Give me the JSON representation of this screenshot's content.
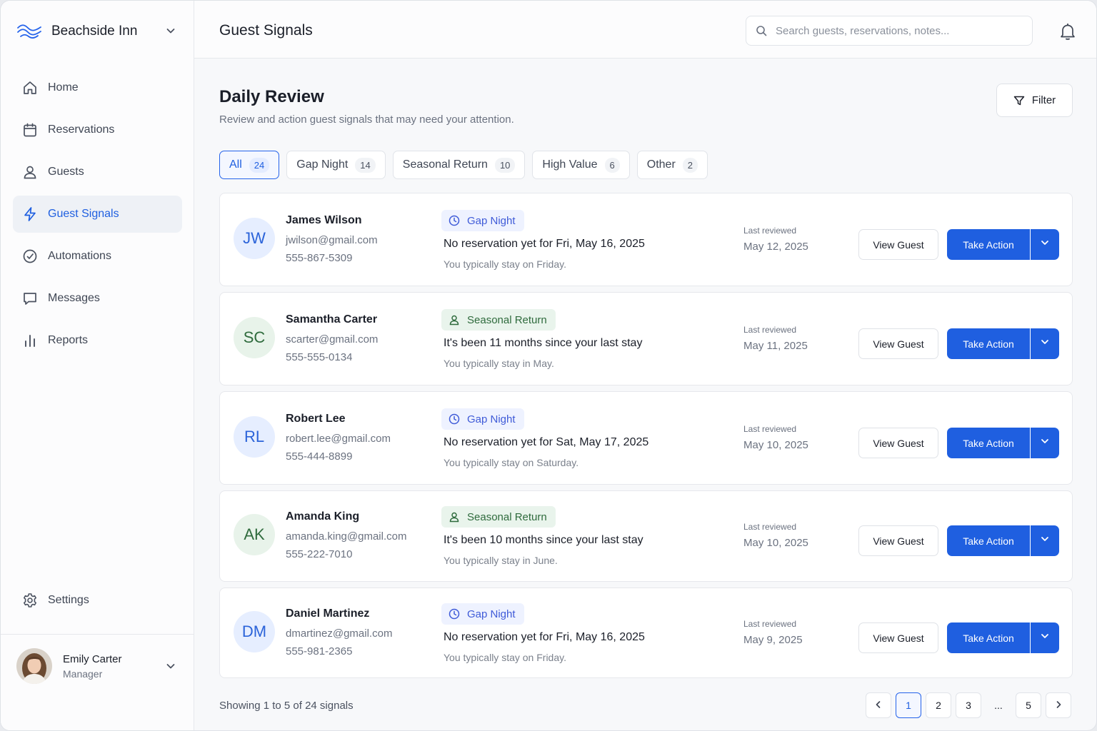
{
  "brand": {
    "name": "Beachside Inn",
    "logo": "waves-icon"
  },
  "sidebar": {
    "items": [
      {
        "label": "Home",
        "icon": "home-icon",
        "key": "home"
      },
      {
        "label": "Reservations",
        "icon": "calendar-icon",
        "key": "reservations"
      },
      {
        "label": "Guests",
        "icon": "user-icon",
        "key": "guests"
      },
      {
        "label": "Guest Signals",
        "icon": "lightning-icon",
        "key": "guest-signals",
        "active": true
      },
      {
        "label": "Automations",
        "icon": "automation-icon",
        "key": "automations"
      },
      {
        "label": "Messages",
        "icon": "message-icon",
        "key": "messages"
      },
      {
        "label": "Reports",
        "icon": "bar-chart-icon",
        "key": "reports"
      }
    ],
    "settings": {
      "label": "Settings",
      "icon": "gear-icon"
    },
    "user": {
      "name": "Emily Carter",
      "role": "Manager"
    }
  },
  "header": {
    "title": "Guest Signals",
    "search_placeholder": "Search guests, reservations, notes..."
  },
  "main": {
    "heading": "Daily Review",
    "subtitle": "Review and action guest signals that may need your attention.",
    "filter_label": "Filter",
    "tabs": [
      {
        "label": "All",
        "count": "24",
        "active": true
      },
      {
        "label": "Gap Night",
        "count": "14"
      },
      {
        "label": "Seasonal Return",
        "count": "10"
      },
      {
        "label": "High Value",
        "count": "6"
      },
      {
        "label": "Other",
        "count": "2"
      }
    ],
    "view_label": "View Guest",
    "action_label": "Take Action",
    "last_reviewed_label": "Last reviewed",
    "signals": [
      {
        "initials": "JW",
        "avatar_color": "blue",
        "name": "James Wilson",
        "email": "jwilson@gmail.com",
        "phone": "555-867-5309",
        "type": "Gap Night",
        "type_key": "gap",
        "title": "No reservation yet for Fri, May 16, 2025",
        "sub": "You typically stay on Friday.",
        "reviewed": "May 12, 2025"
      },
      {
        "initials": "SC",
        "avatar_color": "green",
        "name": "Samantha Carter",
        "email": "scarter@gmail.com",
        "phone": "555-555-0134",
        "type": "Seasonal Return",
        "type_key": "seasonal",
        "title": "It's been 11 months since your last stay",
        "sub": "You typically stay in May.",
        "reviewed": "May 11, 2025"
      },
      {
        "initials": "RL",
        "avatar_color": "blue",
        "name": "Robert Lee",
        "email": "robert.lee@gmail.com",
        "phone": "555-444-8899",
        "type": "Gap Night",
        "type_key": "gap",
        "title": "No reservation yet for Sat, May 17, 2025",
        "sub": "You typically stay on Saturday.",
        "reviewed": "May 10, 2025"
      },
      {
        "initials": "AK",
        "avatar_color": "green",
        "name": "Amanda King",
        "email": "amanda.king@gmail.com",
        "phone": "555-222-7010",
        "type": "Seasonal Return",
        "type_key": "seasonal",
        "title": "It's been 10 months since your last stay",
        "sub": "You typically stay in June.",
        "reviewed": "May 10, 2025"
      },
      {
        "initials": "DM",
        "avatar_color": "blue",
        "name": "Daniel Martinez",
        "email": "dmartinez@gmail.com",
        "phone": "555-981-2365",
        "type": "Gap Night",
        "type_key": "gap",
        "title": "No reservation yet for Fri, May 16, 2025",
        "sub": "You typically stay on Friday.",
        "reviewed": "May 9, 2025"
      }
    ],
    "footer_text": "Showing 1 to 5 of 24 signals",
    "pagination": {
      "pages": [
        "1",
        "2",
        "3",
        "...",
        "5"
      ],
      "current": "1"
    }
  },
  "colors": {
    "accent": "#1f5fe0",
    "gap_badge": "#3f5bd8",
    "seasonal_badge": "#2f6b3d"
  }
}
